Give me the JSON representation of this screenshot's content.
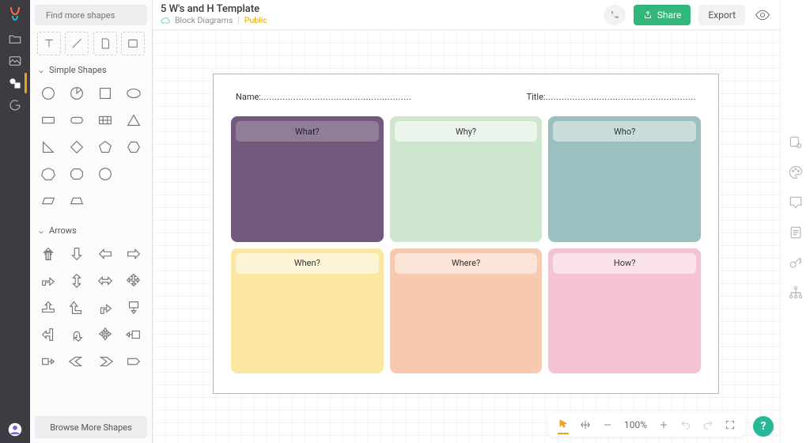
{
  "header": {
    "doc_title": "5 W's and H Template",
    "category": "Block Diagrams",
    "visibility": "Public",
    "share_label": "Share",
    "export_label": "Export"
  },
  "search": {
    "placeholder": "Find more shapes"
  },
  "sections": {
    "simple": "Simple Shapes",
    "arrows": "Arrows"
  },
  "browse_more": "Browse More Shapes",
  "canvas": {
    "name_label": "Name:",
    "title_label": "Title:",
    "dots": "........................................................",
    "cards": {
      "what": "What?",
      "why": "Why?",
      "who": "Who?",
      "when": "When?",
      "where": "Where?",
      "how": "How?"
    }
  },
  "zoom": {
    "level": "100%"
  },
  "help": "?"
}
